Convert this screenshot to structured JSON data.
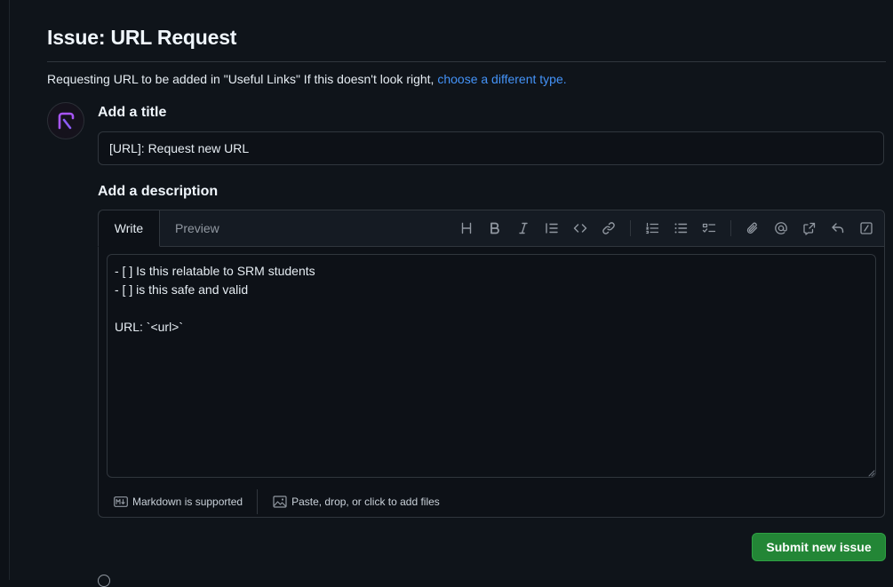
{
  "page": {
    "title": "Issue: URL Request",
    "subline_text": "Requesting URL to be added in \"Useful Links\" If this doesn't look right, ",
    "subline_link": "choose a different type."
  },
  "form": {
    "title_label": "Add a title",
    "title_value": "[URL]: Request new URL",
    "description_label": "Add a description",
    "tabs": {
      "write": "Write",
      "preview": "Preview"
    },
    "body_value": "- [ ] Is this relatable to SRM students\n- [ ] is this safe and valid\n\nURL: `<url>`",
    "toolbar_icons": [
      "heading-icon",
      "bold-icon",
      "italic-icon",
      "quote-icon",
      "code-icon",
      "link-icon",
      "ordered-list-icon",
      "unordered-list-icon",
      "task-list-icon",
      "attach-icon",
      "mention-icon",
      "cross-reference-icon",
      "reply-icon",
      "slash-command-icon"
    ],
    "footer": {
      "markdown": "Markdown is supported",
      "attach": "Paste, drop, or click to add files"
    },
    "submit_label": "Submit new issue"
  },
  "colors": {
    "background": "#0d1117",
    "link": "#4493f8",
    "submit": "#238636",
    "avatar_accent": "#a855f7"
  }
}
